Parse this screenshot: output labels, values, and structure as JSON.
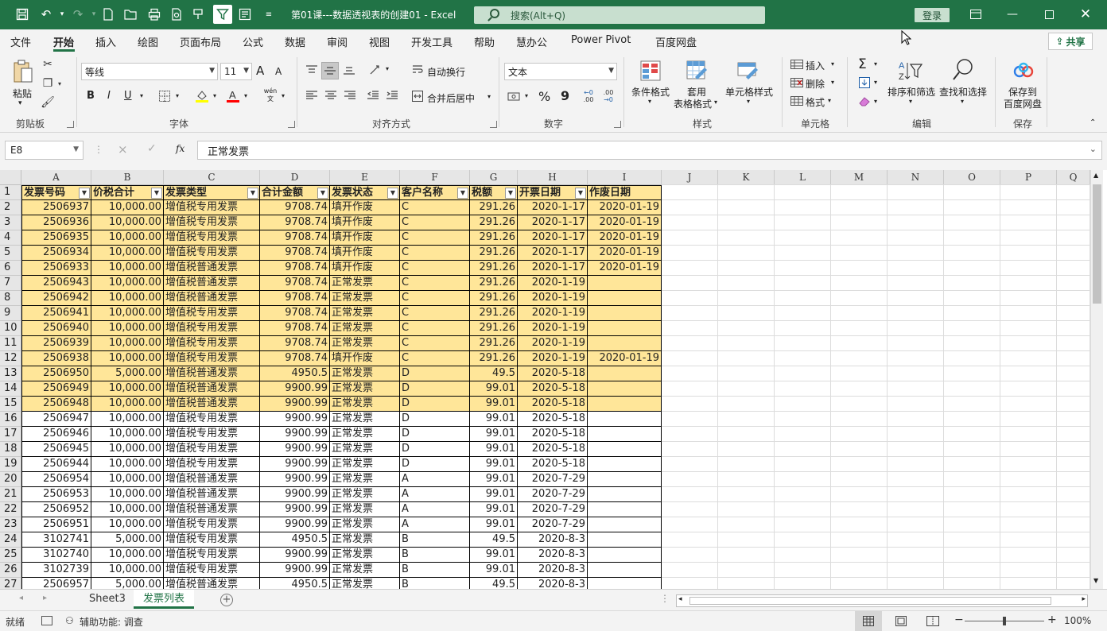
{
  "window": {
    "title": "第01课---数据透视表的创建01 - Excel",
    "search_placeholder": "搜索(Alt+Q)",
    "login_label": "登录",
    "accent": "#217346"
  },
  "menu": {
    "tabs": [
      "文件",
      "开始",
      "插入",
      "绘图",
      "页面布局",
      "公式",
      "数据",
      "审阅",
      "视图",
      "开发工具",
      "帮助",
      "慧办公",
      "Power Pivot",
      "百度网盘"
    ],
    "active": "开始",
    "share_label": "共享"
  },
  "ribbon": {
    "clipboard": {
      "paste_label": "粘贴",
      "group_label": "剪贴板"
    },
    "font": {
      "font_name": "等线",
      "font_size": "11",
      "group_label": "字体",
      "bold": "B",
      "italic": "I",
      "underline": "U",
      "grow": "A",
      "shrink": "A",
      "phonetic": "wén文"
    },
    "alignment": {
      "wrap_label": "自动换行",
      "merge_label": "合并后居中",
      "group_label": "对齐方式"
    },
    "number": {
      "format": "文本",
      "percent": "%",
      "comma": "9",
      "inc_decimal": ".00",
      "dec_decimal": ".00",
      "group_label": "数字"
    },
    "styles": {
      "conditional_label": "条件格式",
      "table_label_1": "套用",
      "table_label_2": "表格格式",
      "cell_style_label": "单元格样式",
      "group_label": "样式"
    },
    "cells": {
      "insert_label": "插入",
      "delete_label": "删除",
      "format_label": "格式",
      "group_label": "单元格"
    },
    "editing": {
      "sort_label": "排序和筛选",
      "find_label": "查找和选择",
      "group_label": "编辑"
    },
    "save": {
      "label_1": "保存到",
      "label_2": "百度网盘",
      "group_label": "保存"
    }
  },
  "formula_bar": {
    "name_box": "E8",
    "cancel": "×",
    "enter": "✓",
    "fx": "fx",
    "content": "正常发票"
  },
  "sheet": {
    "columns": [
      "A",
      "B",
      "C",
      "D",
      "E",
      "F",
      "G",
      "H",
      "I",
      "J",
      "K",
      "L",
      "M",
      "N",
      "O",
      "P",
      "Q"
    ],
    "headers": [
      "发票号码",
      "价税合计",
      "发票类型",
      "合计金额",
      "发票状态",
      "客户名称",
      "税额",
      "开票日期",
      "作废日期"
    ],
    "rows": [
      [
        "2506937",
        "10,000.00",
        "增值税专用发票",
        "9708.74",
        "填开作废",
        "C",
        "291.26",
        "2020-1-17",
        "2020-01-19"
      ],
      [
        "2506936",
        "10,000.00",
        "增值税专用发票",
        "9708.74",
        "填开作废",
        "C",
        "291.26",
        "2020-1-17",
        "2020-01-19"
      ],
      [
        "2506935",
        "10,000.00",
        "增值税专用发票",
        "9708.74",
        "填开作废",
        "C",
        "291.26",
        "2020-1-17",
        "2020-01-19"
      ],
      [
        "2506934",
        "10,000.00",
        "增值税专用发票",
        "9708.74",
        "填开作废",
        "C",
        "291.26",
        "2020-1-17",
        "2020-01-19"
      ],
      [
        "2506933",
        "10,000.00",
        "增值税普通发票",
        "9708.74",
        "填开作废",
        "C",
        "291.26",
        "2020-1-17",
        "2020-01-19"
      ],
      [
        "2506943",
        "10,000.00",
        "增值税普通发票",
        "9708.74",
        "正常发票",
        "C",
        "291.26",
        "2020-1-19",
        ""
      ],
      [
        "2506942",
        "10,000.00",
        "增值税普通发票",
        "9708.74",
        "正常发票",
        "C",
        "291.26",
        "2020-1-19",
        ""
      ],
      [
        "2506941",
        "10,000.00",
        "增值税专用发票",
        "9708.74",
        "正常发票",
        "C",
        "291.26",
        "2020-1-19",
        ""
      ],
      [
        "2506940",
        "10,000.00",
        "增值税专用发票",
        "9708.74",
        "正常发票",
        "C",
        "291.26",
        "2020-1-19",
        ""
      ],
      [
        "2506939",
        "10,000.00",
        "增值税专用发票",
        "9708.74",
        "正常发票",
        "C",
        "291.26",
        "2020-1-19",
        ""
      ],
      [
        "2506938",
        "10,000.00",
        "增值税专用发票",
        "9708.74",
        "填开作废",
        "C",
        "291.26",
        "2020-1-19",
        "2020-01-19"
      ],
      [
        "2506950",
        "5,000.00",
        "增值税普通发票",
        "4950.5",
        "正常发票",
        "D",
        "49.5",
        "2020-5-18",
        ""
      ],
      [
        "2506949",
        "10,000.00",
        "增值税普通发票",
        "9900.99",
        "正常发票",
        "D",
        "99.01",
        "2020-5-18",
        ""
      ],
      [
        "2506948",
        "10,000.00",
        "增值税普通发票",
        "9900.99",
        "正常发票",
        "D",
        "99.01",
        "2020-5-18",
        ""
      ],
      [
        "2506947",
        "10,000.00",
        "增值税专用发票",
        "9900.99",
        "正常发票",
        "D",
        "99.01",
        "2020-5-18",
        ""
      ],
      [
        "2506946",
        "10,000.00",
        "增值税专用发票",
        "9900.99",
        "正常发票",
        "D",
        "99.01",
        "2020-5-18",
        ""
      ],
      [
        "2506945",
        "10,000.00",
        "增值税专用发票",
        "9900.99",
        "正常发票",
        "D",
        "99.01",
        "2020-5-18",
        ""
      ],
      [
        "2506944",
        "10,000.00",
        "增值税专用发票",
        "9900.99",
        "正常发票",
        "D",
        "99.01",
        "2020-5-18",
        ""
      ],
      [
        "2506954",
        "10,000.00",
        "增值税普通发票",
        "9900.99",
        "正常发票",
        "A",
        "99.01",
        "2020-7-29",
        ""
      ],
      [
        "2506953",
        "10,000.00",
        "增值税普通发票",
        "9900.99",
        "正常发票",
        "A",
        "99.01",
        "2020-7-29",
        ""
      ],
      [
        "2506952",
        "10,000.00",
        "增值税普通发票",
        "9900.99",
        "正常发票",
        "A",
        "99.01",
        "2020-7-29",
        ""
      ],
      [
        "2506951",
        "10,000.00",
        "增值税专用发票",
        "9900.99",
        "正常发票",
        "A",
        "99.01",
        "2020-7-29",
        ""
      ],
      [
        "3102741",
        "5,000.00",
        "增值税专用发票",
        "4950.5",
        "正常发票",
        "B",
        "49.5",
        "2020-8-3",
        ""
      ],
      [
        "3102740",
        "10,000.00",
        "增值税专用发票",
        "9900.99",
        "正常发票",
        "B",
        "99.01",
        "2020-8-3",
        ""
      ],
      [
        "3102739",
        "10,000.00",
        "增值税专用发票",
        "9900.99",
        "正常发票",
        "B",
        "99.01",
        "2020-8-3",
        ""
      ],
      [
        "2506957",
        "5,000.00",
        "增值税普通发票",
        "4950.5",
        "正常发票",
        "B",
        "49.5",
        "2020-8-3",
        ""
      ]
    ],
    "highlighted_rows": 14,
    "highlight_color": "#ffe699"
  },
  "sheet_tabs": {
    "tabs": [
      "Sheet3",
      "发票列表"
    ],
    "active": "发票列表"
  },
  "status": {
    "ready": "就绪",
    "accessibility": "辅助功能: 调查",
    "zoom": "100%",
    "zoom_fraction": 0.5
  }
}
